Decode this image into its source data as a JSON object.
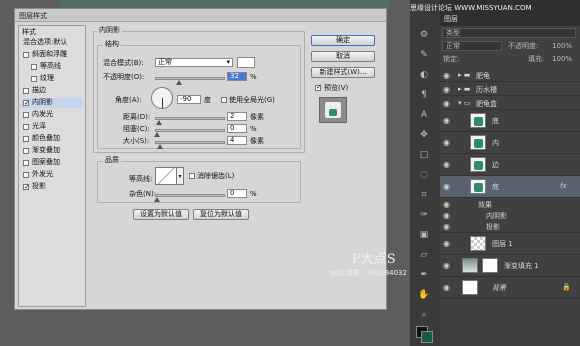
{
  "watermark_top": "思缘设计论坛 WWW.MISSYUAN.COM",
  "watermark_bottom": "P大点S",
  "watermark_bottom_sub": "qq交流群：303184032",
  "dialog": {
    "title": "图层样式",
    "style_list_title": "样式",
    "style_list_items": [
      {
        "label": "混合选项:默认",
        "checked": false,
        "selected": false,
        "indent": false,
        "header": true
      },
      {
        "label": "斜面和浮雕",
        "checked": false,
        "selected": false,
        "indent": false
      },
      {
        "label": "等高线",
        "checked": false,
        "selected": false,
        "indent": true
      },
      {
        "label": "纹理",
        "checked": false,
        "selected": false,
        "indent": true
      },
      {
        "label": "描边",
        "checked": false,
        "selected": false,
        "indent": false
      },
      {
        "label": "内阴影",
        "checked": true,
        "selected": true,
        "indent": false
      },
      {
        "label": "内发光",
        "checked": false,
        "selected": false,
        "indent": false
      },
      {
        "label": "光泽",
        "checked": false,
        "selected": false,
        "indent": false
      },
      {
        "label": "颜色叠加",
        "checked": false,
        "selected": false,
        "indent": false
      },
      {
        "label": "渐变叠加",
        "checked": false,
        "selected": false,
        "indent": false
      },
      {
        "label": "图案叠加",
        "checked": false,
        "selected": false,
        "indent": false
      },
      {
        "label": "外发光",
        "checked": false,
        "selected": false,
        "indent": false
      },
      {
        "label": "投影",
        "checked": true,
        "selected": false,
        "indent": false
      }
    ],
    "section_title": "内阴影",
    "struct_title": "结构",
    "blend_mode_label": "混合模式(B):",
    "blend_mode_value": "正常",
    "opacity_label": "不透明度(O):",
    "opacity_value": "32",
    "opacity_unit": "%",
    "angle_label": "角度(A):",
    "angle_value": "-90",
    "angle_unit": "度",
    "global_light_label": "使用全局光(G)",
    "distance_label": "距离(D):",
    "distance_value": "2",
    "distance_unit": "像素",
    "choke_label": "阻塞(C):",
    "choke_value": "0",
    "choke_unit": "%",
    "size_label": "大小(S):",
    "size_value": "4",
    "size_unit": "像素",
    "quality_title": "品质",
    "contour_label": "等高线:",
    "antialias_label": "消除锯齿(L)",
    "noise_label": "杂色(N):",
    "noise_value": "0",
    "noise_unit": "%",
    "make_default_label": "设置为默认值",
    "reset_default_label": "复位为默认值",
    "ok_label": "确定",
    "cancel_label": "取消",
    "new_style_label": "新建样式(W)...",
    "preview_label": "预览(V)"
  },
  "layers_panel": {
    "tab_label": "图层",
    "kind_label": "类型",
    "normal_label": "正常",
    "opacity_label": "不透明度:",
    "opacity_value": "100%",
    "lock_label": "锁定:",
    "fill_label": "填充:",
    "fill_value": "100%",
    "rows": [
      {
        "name": "肥龟",
        "type": "folder"
      },
      {
        "name": "历水槽",
        "type": "folder"
      },
      {
        "name": "肥龟盒",
        "type": "folder-open"
      },
      {
        "name": "底",
        "type": "layer"
      },
      {
        "name": "内",
        "type": "layer"
      },
      {
        "name": "边",
        "type": "layer"
      },
      {
        "name": "底",
        "type": "layer-selected",
        "fx": "fx"
      },
      {
        "name": "效果",
        "type": "fx-group"
      },
      {
        "name": "内阴影",
        "type": "fx-item"
      },
      {
        "name": "投影",
        "type": "fx-item"
      },
      {
        "name": "图层 1",
        "type": "layer"
      },
      {
        "name": "渐变填充 1",
        "type": "gradient"
      },
      {
        "name": "背景",
        "type": "background"
      }
    ]
  }
}
